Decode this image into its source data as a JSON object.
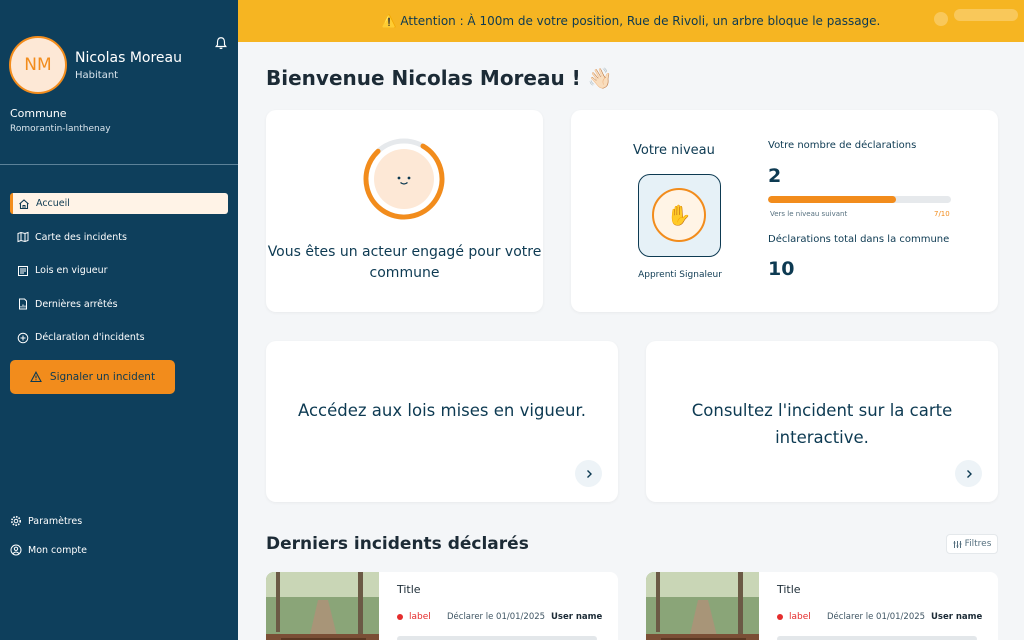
{
  "user": {
    "initials": "NM",
    "name": "Nicolas Moreau",
    "role": "Habitant"
  },
  "commune": {
    "label": "Commune",
    "value": "Romorantin-lanthenay"
  },
  "nav": [
    {
      "label": "Accueil",
      "icon": "home-icon",
      "active": true
    },
    {
      "label": "Carte des incidents",
      "icon": "map-icon"
    },
    {
      "label": "Lois en vigueur",
      "icon": "law-icon"
    },
    {
      "label": "Dernières arrêtés",
      "icon": "document-icon"
    },
    {
      "label": "Déclaration d'incidents",
      "icon": "plus-circle-icon"
    }
  ],
  "signal_button": "Signaler un incident",
  "bottom_nav": [
    {
      "label": "Paramètres",
      "icon": "gear-icon"
    },
    {
      "label": "Mon compte",
      "icon": "user-icon"
    }
  ],
  "banner": "⚠️ Attention : À 100m de votre position, Rue de Rivoli, un arbre bloque le passage.",
  "welcome": "Bienvenue Nicolas Moreau ! 👋🏻",
  "engagement_text": "Vous êtes un acteur engagé pour votre commune",
  "level": {
    "title": "Votre niveau",
    "badge_label": "Apprenti Signaleur",
    "declarations_title": "Votre nombre de déclarations",
    "declarations_count": "2",
    "progress_fraction": 0.7,
    "progress_label": "Vers le niveau suivant",
    "progress_count": "7/10",
    "total_title": "Déclarations total dans la commune",
    "total_count": "10"
  },
  "links": {
    "laws": "Accédez aux lois mises en vigueur.",
    "map": "Consultez l'incident sur la carte interactive."
  },
  "section_title": "Derniers incidents déclarés",
  "filter_label": "Filtres",
  "incidents": [
    {
      "title": "Title",
      "label": "label",
      "date": "Déclarer le 01/01/2025",
      "user": "User name"
    },
    {
      "title": "Title",
      "label": "label",
      "date": "Déclarer le 01/01/2025",
      "user": "User name"
    }
  ],
  "colors": {
    "sidebar": "#0e3f5c",
    "accent": "#f28c1c",
    "banner": "#f6b522",
    "label_red": "#e52d2d"
  }
}
